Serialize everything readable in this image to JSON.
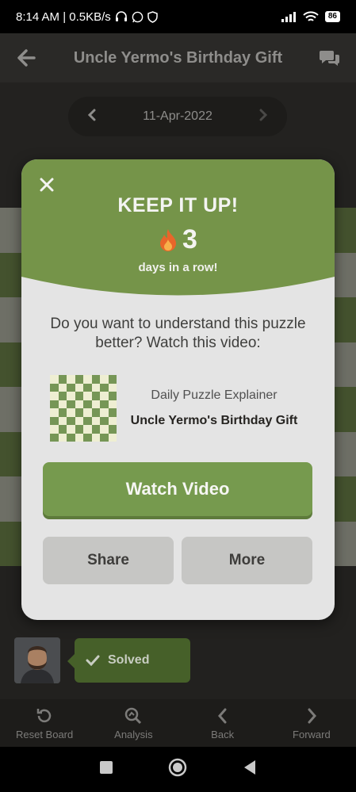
{
  "status_bar": {
    "time_speed": "8:14 AM | 0.5KB/s",
    "battery": "86"
  },
  "header": {
    "title": "Uncle Yermo's Birthday Gift"
  },
  "date_nav": {
    "date": "11-Apr-2022"
  },
  "modal": {
    "title": "KEEP IT UP!",
    "streak_count": "3",
    "streak_caption": "days in a row!",
    "question": "Do you want to understand this puzzle better? Watch this video:",
    "video_subtitle": "Daily Puzzle Explainer",
    "video_title": "Uncle Yermo's Birthday Gift",
    "watch_label": "Watch Video",
    "share_label": "Share",
    "more_label": "More"
  },
  "solved": {
    "label": "Solved"
  },
  "bottom_nav": {
    "items": [
      {
        "label": "Reset Board",
        "icon": "reset-icon"
      },
      {
        "label": "Analysis",
        "icon": "analysis-icon"
      },
      {
        "label": "Back",
        "icon": "chevron-left-icon"
      },
      {
        "label": "Forward",
        "icon": "chevron-right-icon"
      }
    ]
  },
  "colors": {
    "accent_green": "#769a4e",
    "modal_bg": "#e4e4e4",
    "button_gray": "#c6c6c4"
  }
}
